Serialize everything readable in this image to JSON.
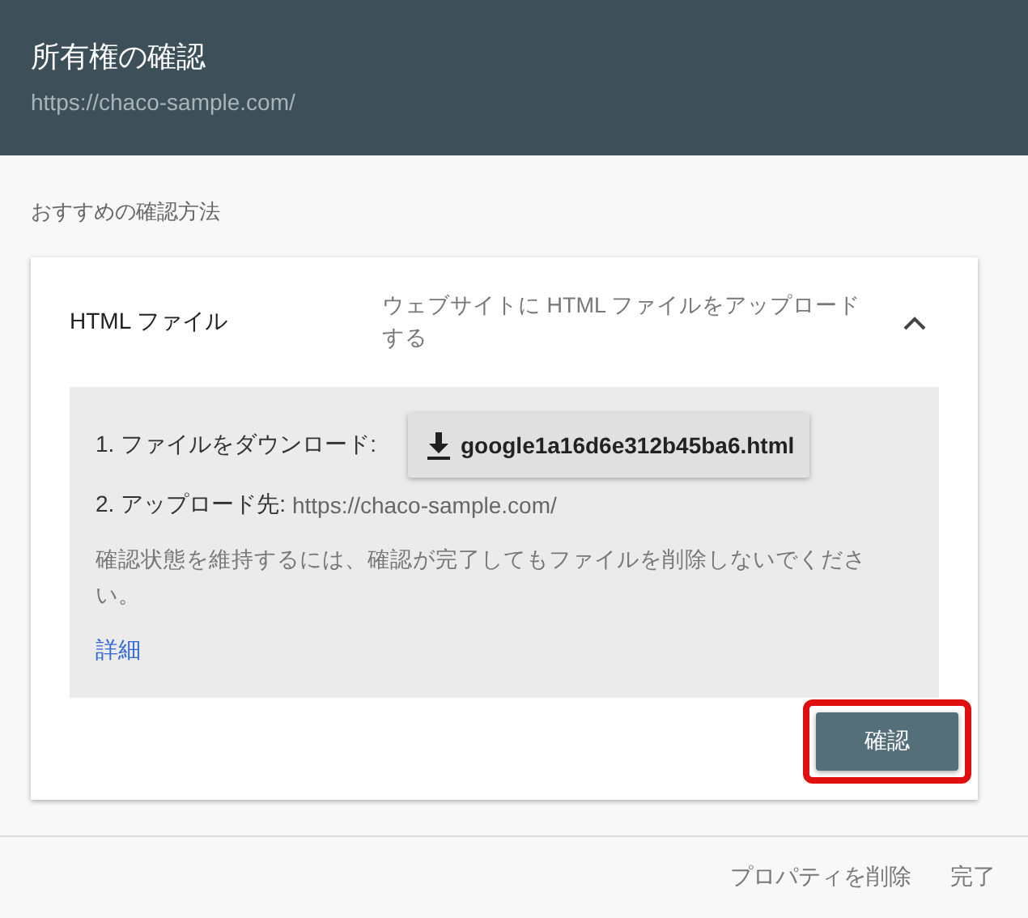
{
  "header": {
    "title": "所有権の確認",
    "url": "https://chaco-sample.com/"
  },
  "section_label": "おすすめの確認方法",
  "method": {
    "name": "HTML ファイル",
    "description": "ウェブサイトに HTML ファイルをアップロードする",
    "expanded": true,
    "steps": [
      {
        "kind": "download",
        "label": "1. ファイルをダウンロード:",
        "file": "google1a16d6e312b45ba6.html"
      },
      {
        "kind": "text",
        "label": "2. アップロード先:",
        "value": "https://chaco-sample.com/"
      }
    ],
    "note": "確認状態を維持するには、確認が完了してもファイルを削除しないでください。",
    "link": "詳細",
    "confirm_button": {
      "label": "確認",
      "highlighted": true
    }
  },
  "footer": {
    "buttons": [
      "プロパティを削除",
      "完了"
    ]
  }
}
